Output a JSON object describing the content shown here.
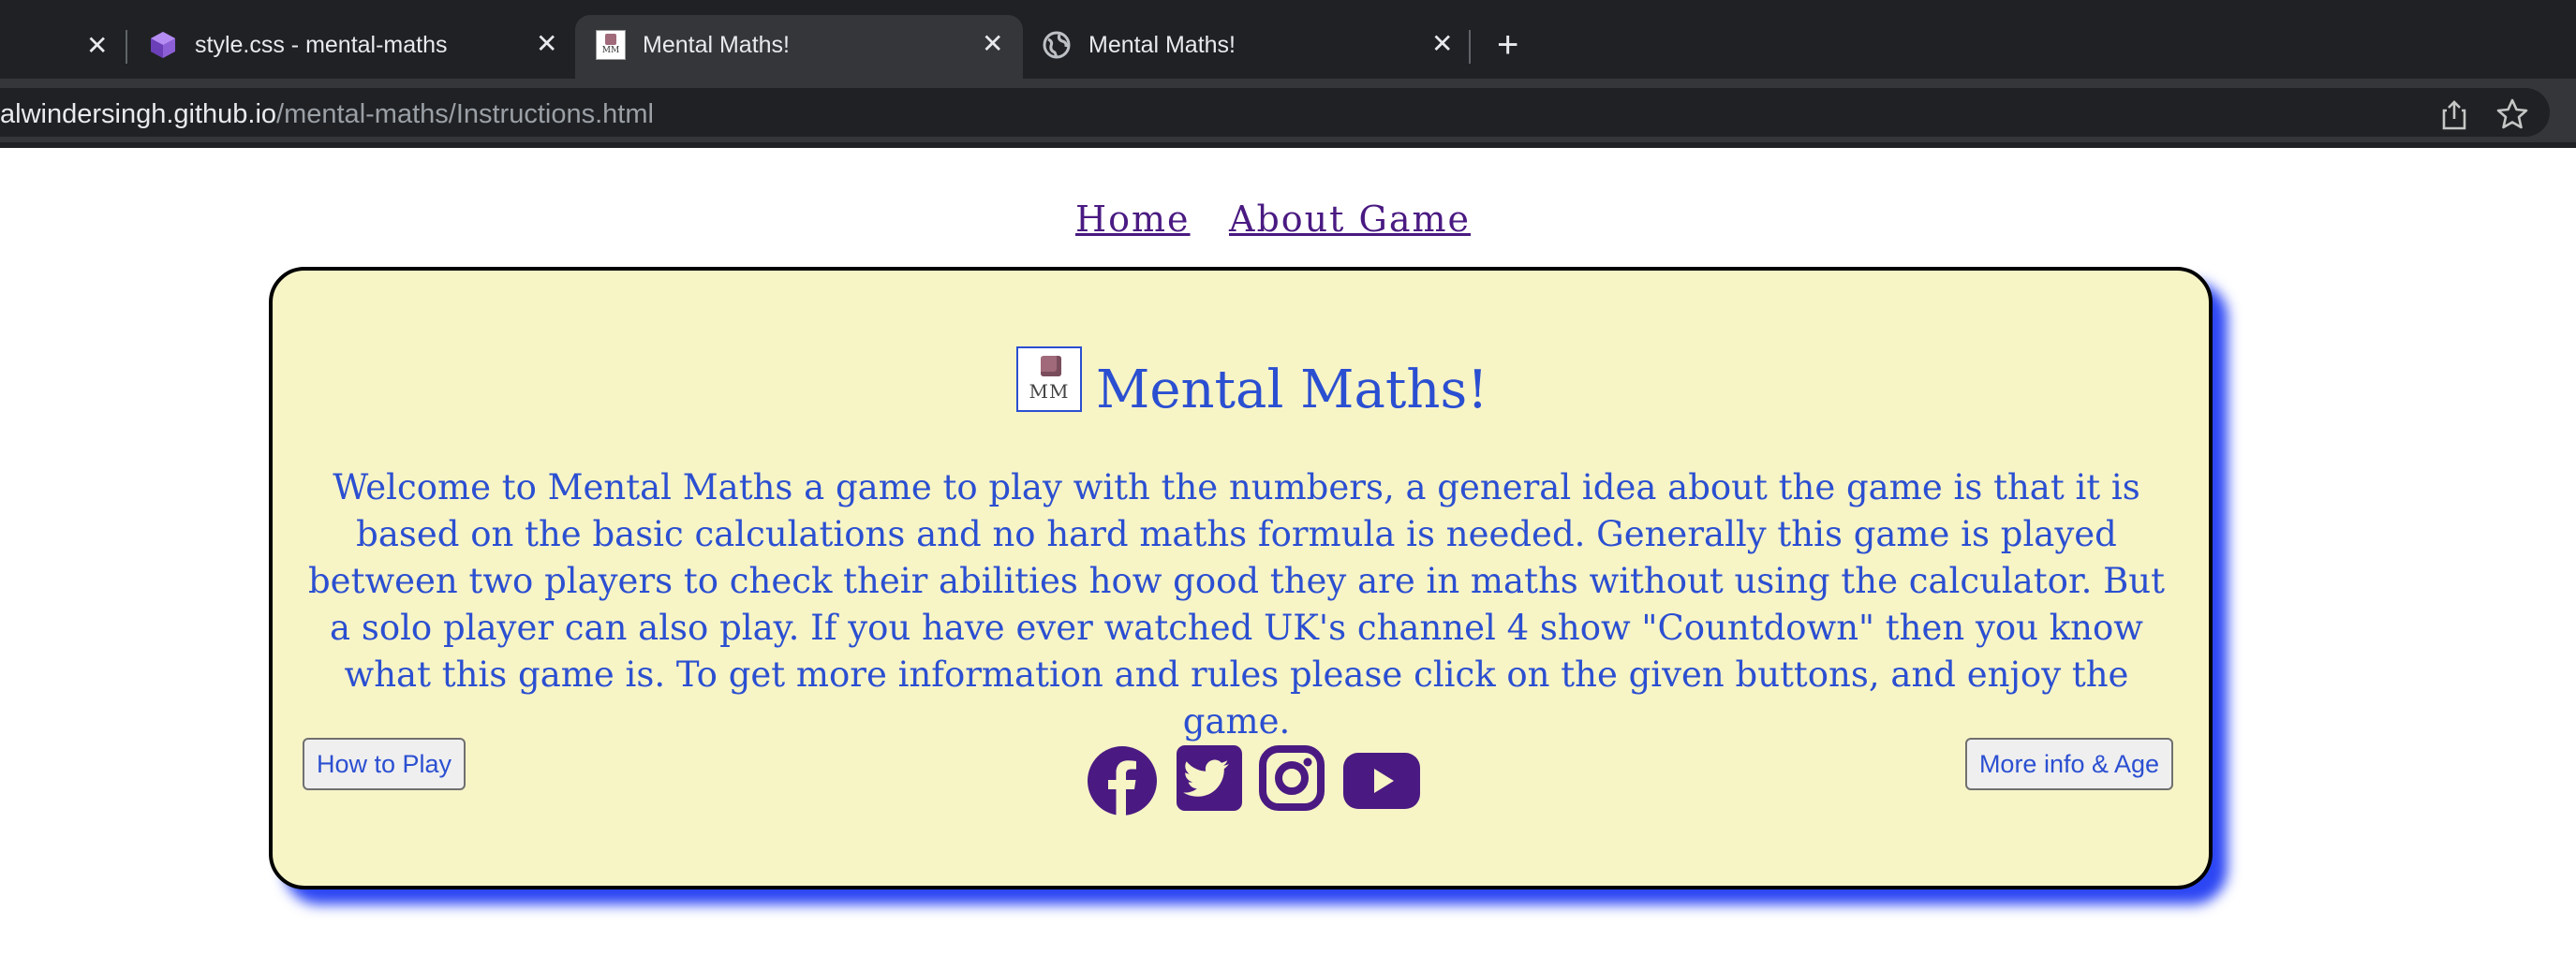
{
  "browser": {
    "tabs": [
      {
        "title": "style.css - mental-maths",
        "active": false
      },
      {
        "title": "Mental Maths!",
        "active": true
      },
      {
        "title": "Mental Maths!",
        "active": false
      }
    ],
    "url_host": "alwindersingh.github.io",
    "url_path": "/mental-maths/Instructions.html",
    "close_glyph": "✕",
    "new_tab_glyph": "+"
  },
  "nav": {
    "home": "Home",
    "about": "About Game"
  },
  "card": {
    "logo_text": "MM",
    "title": "Mental Maths!",
    "intro": "Welcome to Mental Maths a game to play with the numbers, a general idea about the game is that it is based on the basic calculations and no hard maths formula is needed. Generally this game is played between two players to check their abilities how good they are in maths without using the calculator. But a solo player can also play. If you have ever watched UK's channel 4 show \"Countdown\" then you know what this game is. To get more information and rules please click on the given buttons, and enjoy the game.",
    "how_to_play": "How to Play",
    "more_info": "More info & Age"
  },
  "social": [
    "facebook-icon",
    "twitter-icon",
    "instagram-icon",
    "youtube-icon"
  ],
  "colors": {
    "text_blue": "#2b4fd1",
    "social_purple": "#4a1a82",
    "card_bg": "#f7f4c6",
    "card_shadow": "#2c46f4"
  }
}
